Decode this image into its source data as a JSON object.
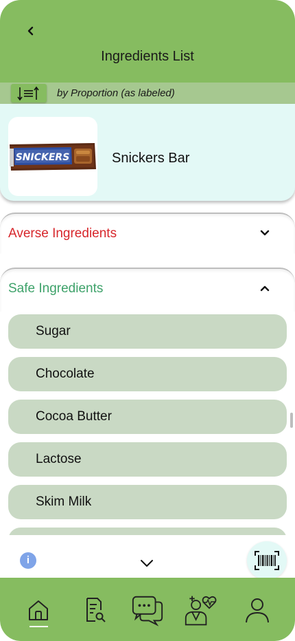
{
  "header": {
    "title": "Ingredients List",
    "back_icon": "chevron-left-icon"
  },
  "sort": {
    "icon": "sort-icon",
    "label": "by Proportion (as labeled)"
  },
  "product": {
    "name": "Snickers Bar",
    "image_brand_text": "SNICKERS"
  },
  "sections": {
    "averse": {
      "title": "Averse Ingredients",
      "expanded": false,
      "color": "#d7262b"
    },
    "safe": {
      "title": "Safe Ingredients",
      "expanded": true,
      "color": "#3ea26a"
    }
  },
  "safe_ingredients": [
    "Sugar",
    "Chocolate",
    "Cocoa Butter",
    "Lactose",
    "Skim Milk"
  ],
  "bottom": {
    "info_icon": "info-icon",
    "info_glyph": "i",
    "more_icon": "chevron-down-icon",
    "scan_icon": "barcode-scan-icon"
  },
  "nav": {
    "items": [
      {
        "icon": "home-icon",
        "active": true
      },
      {
        "icon": "document-search-icon",
        "active": false
      },
      {
        "icon": "chat-icon",
        "active": false
      },
      {
        "icon": "doctor-icon",
        "active": false
      },
      {
        "icon": "profile-icon",
        "active": false
      }
    ]
  },
  "colors": {
    "header_green": "#86bc60",
    "sort_bar": "#a6c890",
    "card_bg": "#e3f9f6",
    "ingredient_bg": "#c9d9c4"
  }
}
